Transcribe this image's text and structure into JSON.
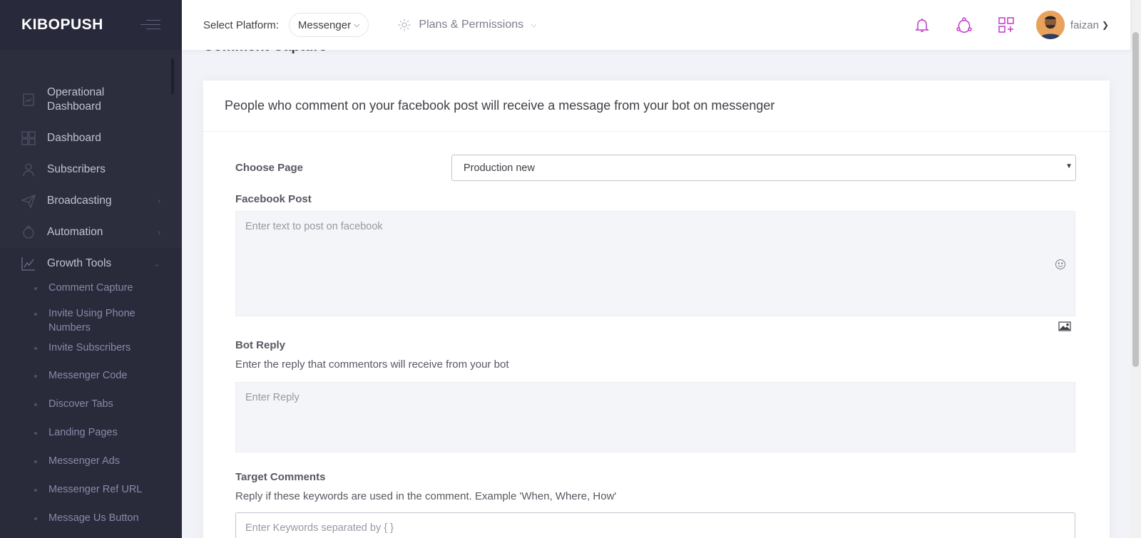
{
  "sidebar": {
    "brand": "KIBOPUSH",
    "items": [
      {
        "label": "Operational Dashboard",
        "icon": "chart-icon"
      },
      {
        "label": "Dashboard",
        "icon": "grid-icon"
      },
      {
        "label": "Subscribers",
        "icon": "user-icon"
      },
      {
        "label": "Broadcasting",
        "icon": "paper-plane-icon"
      },
      {
        "label": "Automation",
        "icon": "automation-icon"
      },
      {
        "label": "Growth Tools",
        "icon": "line-chart-icon"
      }
    ],
    "growth_tools": [
      "Comment Capture",
      "Invite Using Phone Numbers",
      "Invite Subscribers",
      "Messenger Code",
      "Discover Tabs",
      "Landing Pages",
      "Messenger Ads",
      "Messenger Ref URL",
      "Message Us Button"
    ]
  },
  "header": {
    "platform_label": "Select Platform:",
    "platform_value": "Messenger",
    "plans_label": "Plans & Permissions",
    "username": "faizan",
    "accent_color": "#c139c9"
  },
  "page": {
    "title": "Comment Capture",
    "portlet_title": "People who comment on your facebook post will receive a message from your bot on messenger",
    "choose_page_label": "Choose Page",
    "choose_page_value": "Production new",
    "facebook_post_label": "Facebook Post",
    "facebook_post_placeholder": "Enter text to post on facebook",
    "bot_reply_label": "Bot Reply",
    "bot_reply_help": "Enter the reply that commentors will receive from your bot",
    "bot_reply_placeholder": "Enter Reply",
    "target_label": "Target Comments",
    "target_help": "Reply if these keywords are used in the comment. Example 'When, Where, How'",
    "keywords_placeholder": "Enter Keywords separated by { }"
  }
}
